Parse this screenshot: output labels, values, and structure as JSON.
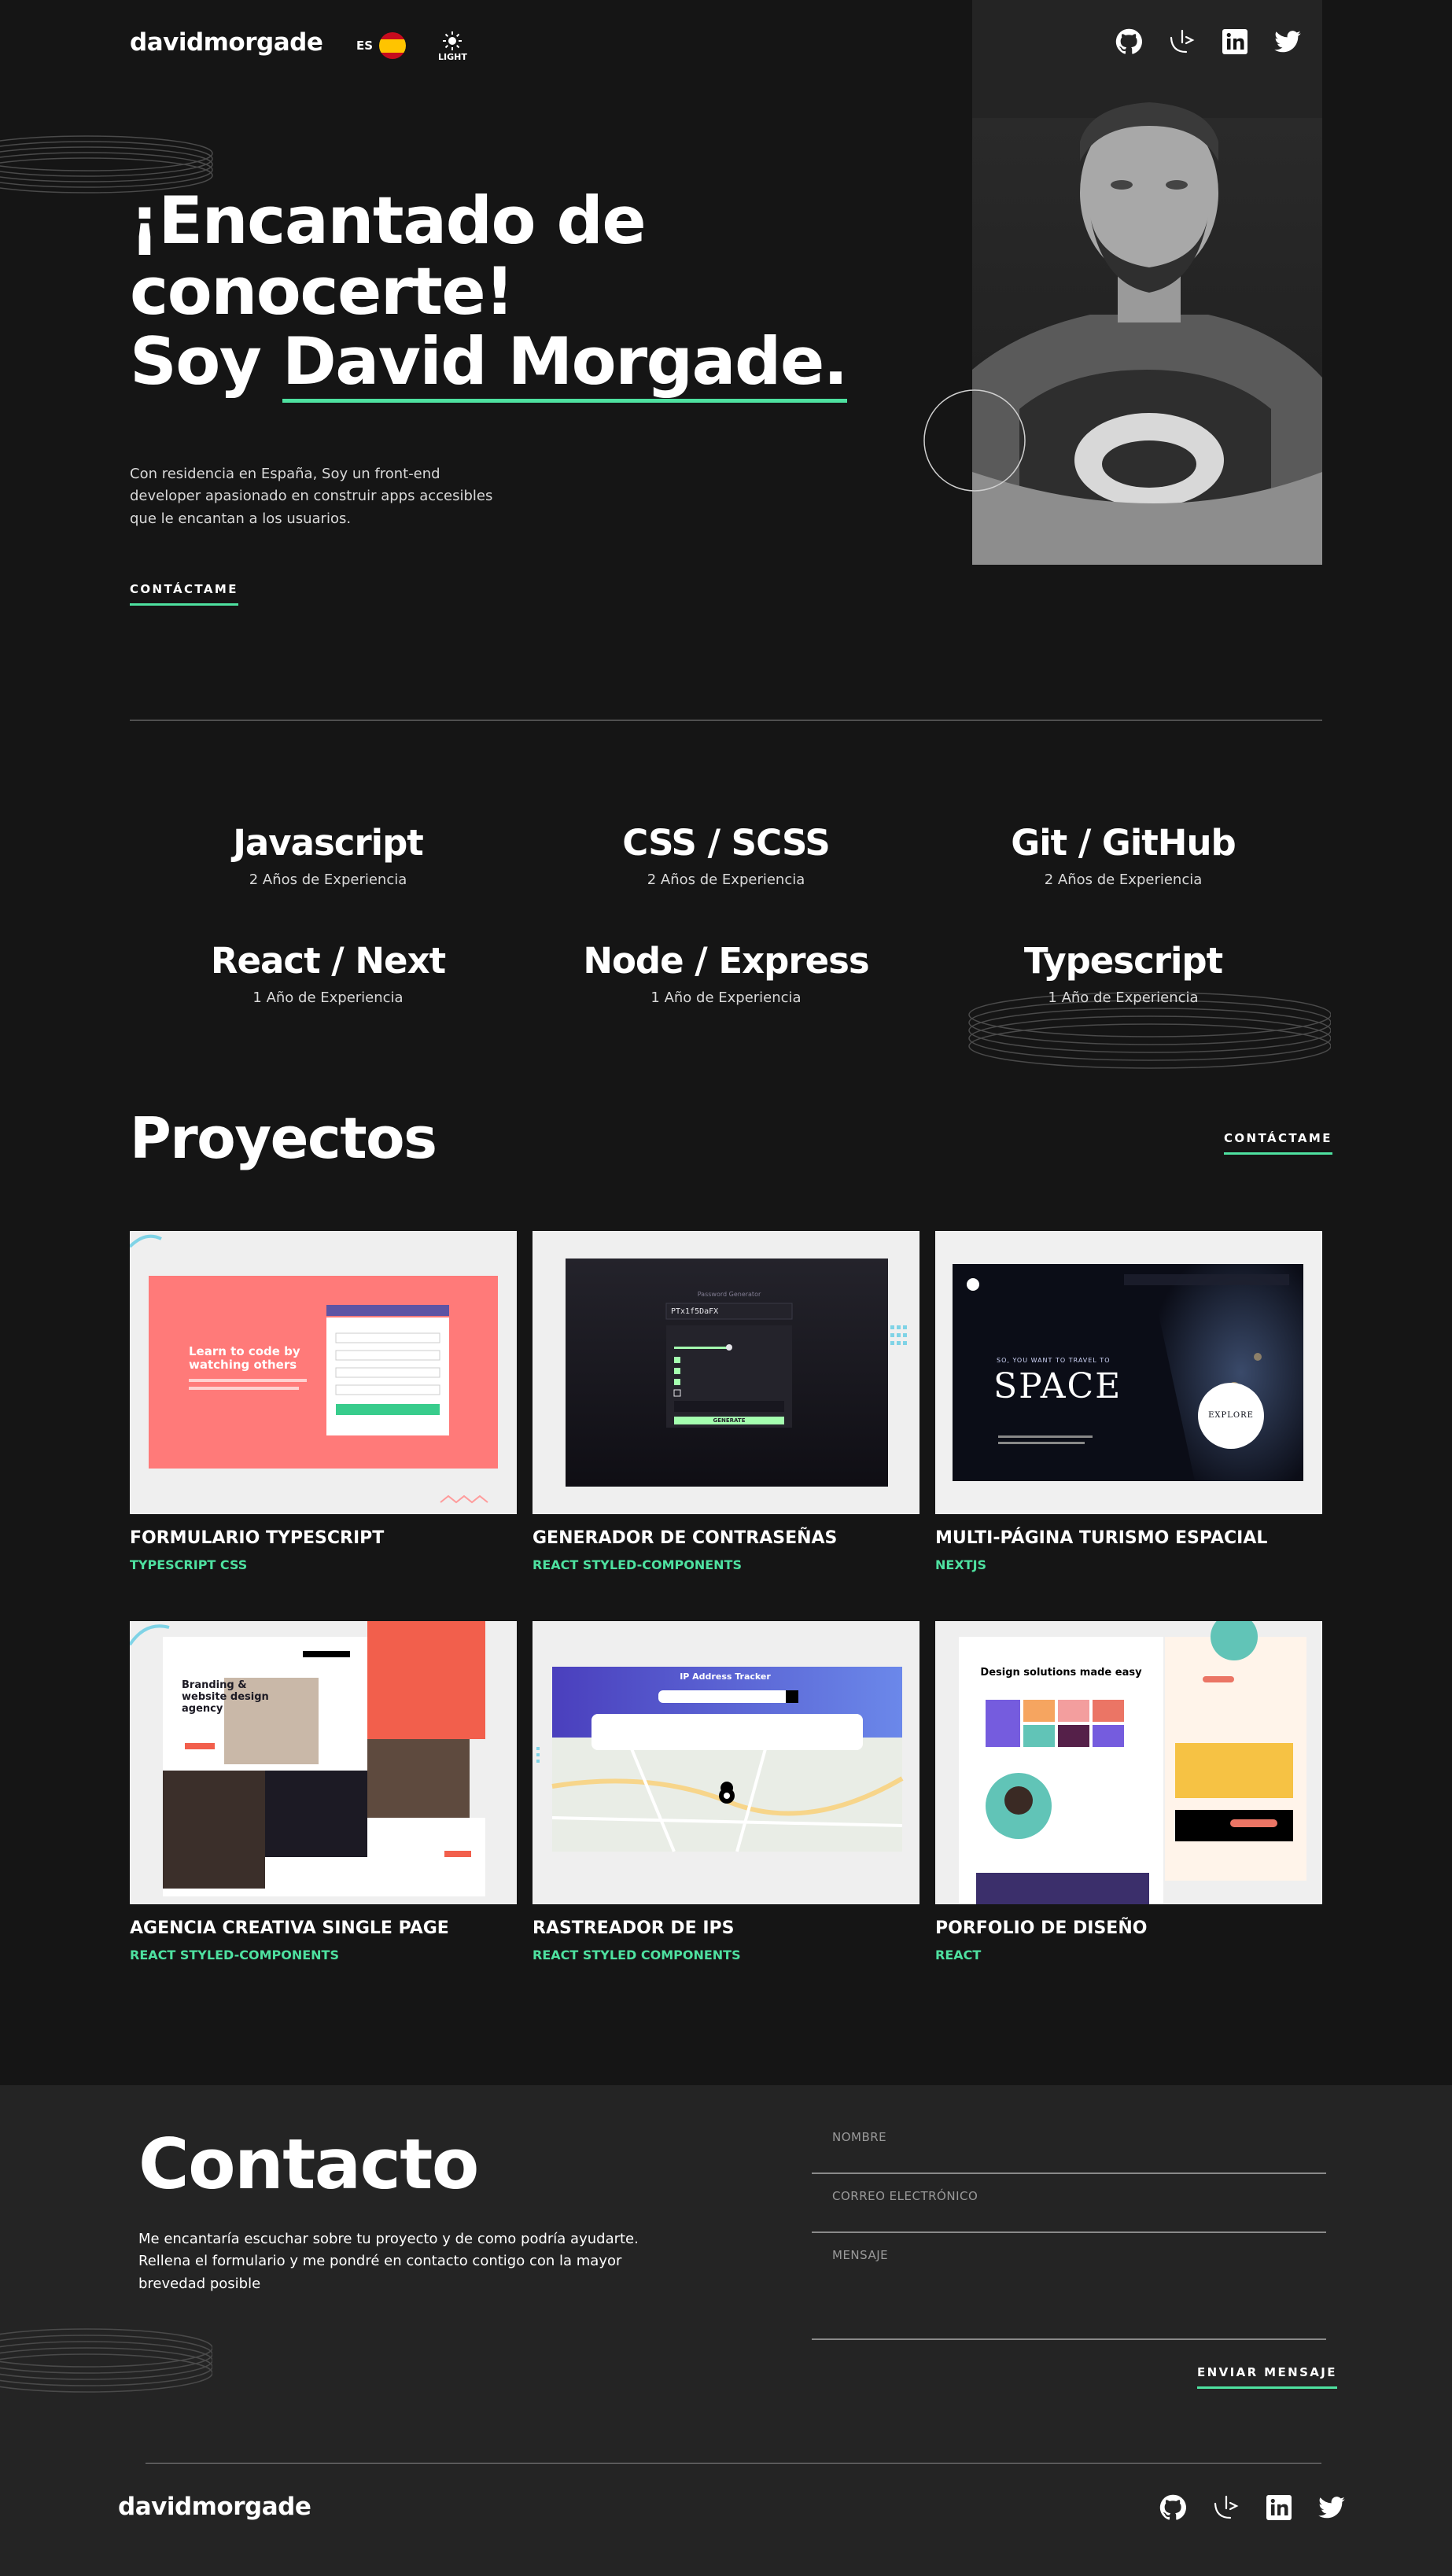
{
  "header": {
    "logo": "davidmorgade",
    "lang_label": "ES",
    "theme_label": "LIGHT"
  },
  "hero": {
    "title_line1": "¡Encantado de",
    "title_line2": "conocerte!",
    "title_line3_prefix": "Soy ",
    "title_name": "David Morgade.",
    "intro": "Con residencia en España, Soy un front-end developer apasionado en construir apps accesibles que le encantan a los usuarios.",
    "cta": "CONTÁCTAME"
  },
  "skills": [
    {
      "name": "Javascript",
      "exp": "2 Años de Experiencia"
    },
    {
      "name": "CSS / SCSS",
      "exp": "2 Años de Experiencia"
    },
    {
      "name": "Git / GitHub",
      "exp": "2 Años de Experiencia"
    },
    {
      "name": "React / Next",
      "exp": "1 Año de Experiencia"
    },
    {
      "name": "Node / Express",
      "exp": "1 Año de Experiencia"
    },
    {
      "name": "Typescript",
      "exp": "1 Año de Experiencia"
    }
  ],
  "projects_section": {
    "title": "Proyectos",
    "cta": "CONTÁCTAME",
    "items": [
      {
        "title": "FORMULARIO TYPESCRIPT",
        "tags": "TYPESCRIPT CSS"
      },
      {
        "title": "GENERADOR DE CONTRASEÑAS",
        "tags": "REACT STYLED-COMPONENTS"
      },
      {
        "title": "MULTI-PÁGINA TURISMO ESPACIAL",
        "tags": "NEXTJS"
      },
      {
        "title": "AGENCIA CREATIVA SINGLE PAGE",
        "tags": "REACT STYLED-COMPONENTS"
      },
      {
        "title": "RASTREADOR DE IPS",
        "tags": "REACT STYLED COMPONENTS"
      },
      {
        "title": "PORFOLIO DE DISEÑO",
        "tags": "REACT"
      }
    ]
  },
  "thumbs": {
    "t1_heading": "Learn to code by watching others",
    "t2_heading": "Password Generator",
    "t2_password": "PTx1f5DaFX",
    "t2_generate": "GENERATE",
    "t3_kicker": "SO, YOU WANT TO TRAVEL TO",
    "t3_title": "SPACE",
    "t3_explore": "EXPLORE",
    "t4_heading": "Branding & website design agency",
    "t5_heading": "IP Address Tracker",
    "t6_heading": "Design solutions made easy"
  },
  "contact": {
    "title": "Contacto",
    "text": "Me encantaría escuchar sobre tu proyecto y de como podría ayudarte. Rellena el formulario y me pondré en contacto contigo con la mayor brevedad posible",
    "name_placeholder": "NOMBRE",
    "email_placeholder": "CORREO ELECTRÓNICO",
    "message_placeholder": "MENSAJE",
    "submit": "ENVIAR MENSAJE"
  },
  "footer": {
    "logo": "davidmorgade"
  },
  "colors": {
    "background": "#151515",
    "panel": "#242424",
    "accent": "#4ee1a0"
  },
  "icons": [
    "github-icon",
    "frontend-mentor-icon",
    "linkedin-icon",
    "twitter-icon",
    "sun-icon",
    "spain-flag-icon"
  ]
}
